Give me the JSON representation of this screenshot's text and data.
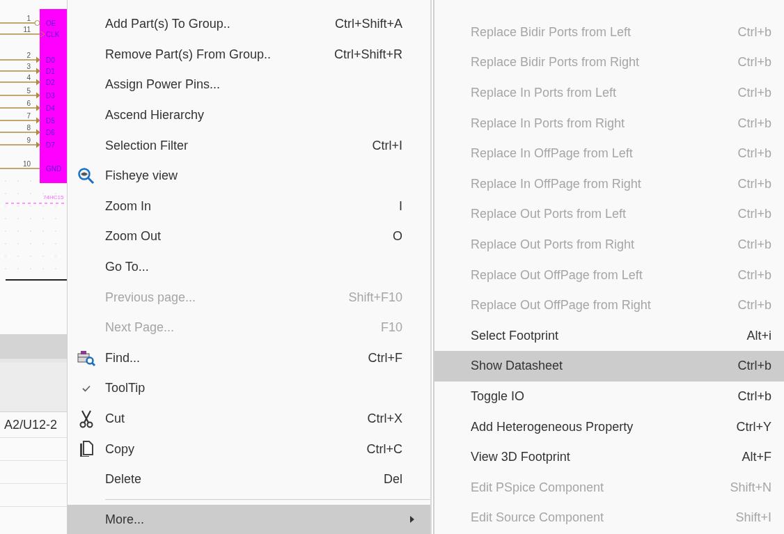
{
  "schematic": {
    "part_label": "74HC15",
    "pins": [
      {
        "number": "1",
        "name": "OE",
        "kind": "inverted"
      },
      {
        "number": "11",
        "name": "CLK",
        "kind": "clock"
      },
      {
        "number": "2",
        "name": "D0",
        "kind": "input"
      },
      {
        "number": "3",
        "name": "D1",
        "kind": "input"
      },
      {
        "number": "4",
        "name": "D2",
        "kind": "input"
      },
      {
        "number": "5",
        "name": "D3",
        "kind": "input"
      },
      {
        "number": "6",
        "name": "D4",
        "kind": "input"
      },
      {
        "number": "7",
        "name": "D5",
        "kind": "input"
      },
      {
        "number": "8",
        "name": "D6",
        "kind": "input"
      },
      {
        "number": "9",
        "name": "D7",
        "kind": "input"
      },
      {
        "number": "10",
        "name": "GND",
        "kind": "plain"
      }
    ]
  },
  "table": {
    "cell": "A2/U12-2"
  },
  "context_menu": {
    "items": [
      {
        "label": "Add Part(s) To Group..",
        "shortcut": "Ctrl+Shift+A",
        "disabled": false
      },
      {
        "label": "Remove Part(s) From Group..",
        "shortcut": "Ctrl+Shift+R",
        "disabled": false
      },
      {
        "label": "Assign Power Pins...",
        "disabled": false
      },
      {
        "label": "Ascend Hierarchy",
        "disabled": false
      },
      {
        "label": "Selection Filter",
        "shortcut": "Ctrl+I",
        "disabled": false
      },
      {
        "label": "Fisheye view",
        "kind": "fisheye",
        "disabled": false
      },
      {
        "label": "Zoom In",
        "shortcut": "I",
        "disabled": false
      },
      {
        "label": "Zoom Out",
        "shortcut": "O",
        "disabled": false
      },
      {
        "label": "Go To...",
        "disabled": false
      },
      {
        "label": "Previous page...",
        "shortcut": "Shift+F10",
        "disabled": true
      },
      {
        "label": "Next Page...",
        "shortcut": "F10",
        "disabled": true
      },
      {
        "label": "Find...",
        "shortcut": "Ctrl+F",
        "kind": "find",
        "disabled": false
      },
      {
        "label": "ToolTip",
        "checked": true,
        "disabled": false
      },
      {
        "label": "Cut",
        "shortcut": "Ctrl+X",
        "kind": "cut",
        "disabled": false
      },
      {
        "label": "Copy",
        "shortcut": "Ctrl+C",
        "kind": "copy",
        "disabled": false
      },
      {
        "label": "Delete",
        "shortcut": "Del",
        "disabled": false
      },
      {
        "label": "More...",
        "submenu": true,
        "selected": true,
        "separator_before": true,
        "disabled": false
      }
    ]
  },
  "submenu": {
    "items": [
      {
        "label": "Replace Bidir Ports from Left",
        "shortcut": "Ctrl+b",
        "disabled": true,
        "selected": false
      },
      {
        "label": "Replace Bidir Ports from Right",
        "shortcut": "Ctrl+b",
        "disabled": true,
        "selected": false
      },
      {
        "label": "Replace In Ports from Left",
        "shortcut": "Ctrl+b",
        "disabled": true,
        "selected": false
      },
      {
        "label": "Replace In Ports from Right",
        "shortcut": "Ctrl+b",
        "disabled": true,
        "selected": false
      },
      {
        "label": "Replace In OffPage from Left",
        "shortcut": "Ctrl+b",
        "disabled": true,
        "selected": false
      },
      {
        "label": "Replace In OffPage from Right",
        "shortcut": "Ctrl+b",
        "disabled": true,
        "selected": false
      },
      {
        "label": "Replace Out Ports from Left",
        "shortcut": "Ctrl+b",
        "disabled": true,
        "selected": false
      },
      {
        "label": "Replace Out Ports from Right",
        "shortcut": "Ctrl+b",
        "disabled": true,
        "selected": false
      },
      {
        "label": "Replace Out OffPage from Left",
        "shortcut": "Ctrl+b",
        "disabled": true,
        "selected": false
      },
      {
        "label": "Replace Out OffPage from Right",
        "shortcut": "Ctrl+b",
        "disabled": true,
        "selected": false
      },
      {
        "label": "Select Footprint",
        "shortcut": "Alt+i",
        "disabled": false,
        "selected": false
      },
      {
        "label": "Show Datasheet",
        "shortcut": "Ctrl+b",
        "disabled": false,
        "selected": true
      },
      {
        "label": "Toggle IO",
        "shortcut": "Ctrl+b",
        "disabled": false,
        "selected": false
      },
      {
        "label": "Add Heterogeneous Property",
        "shortcut": "Ctrl+Y",
        "disabled": false,
        "selected": false
      },
      {
        "label": "View 3D Footprint",
        "shortcut": "Alt+F",
        "disabled": false,
        "selected": false
      },
      {
        "label": "Edit PSpice Component",
        "shortcut": "Shift+N",
        "disabled": true,
        "selected": false
      },
      {
        "label": "Edit Source Component",
        "shortcut": "Shift+I",
        "disabled": true,
        "selected": false
      }
    ]
  }
}
